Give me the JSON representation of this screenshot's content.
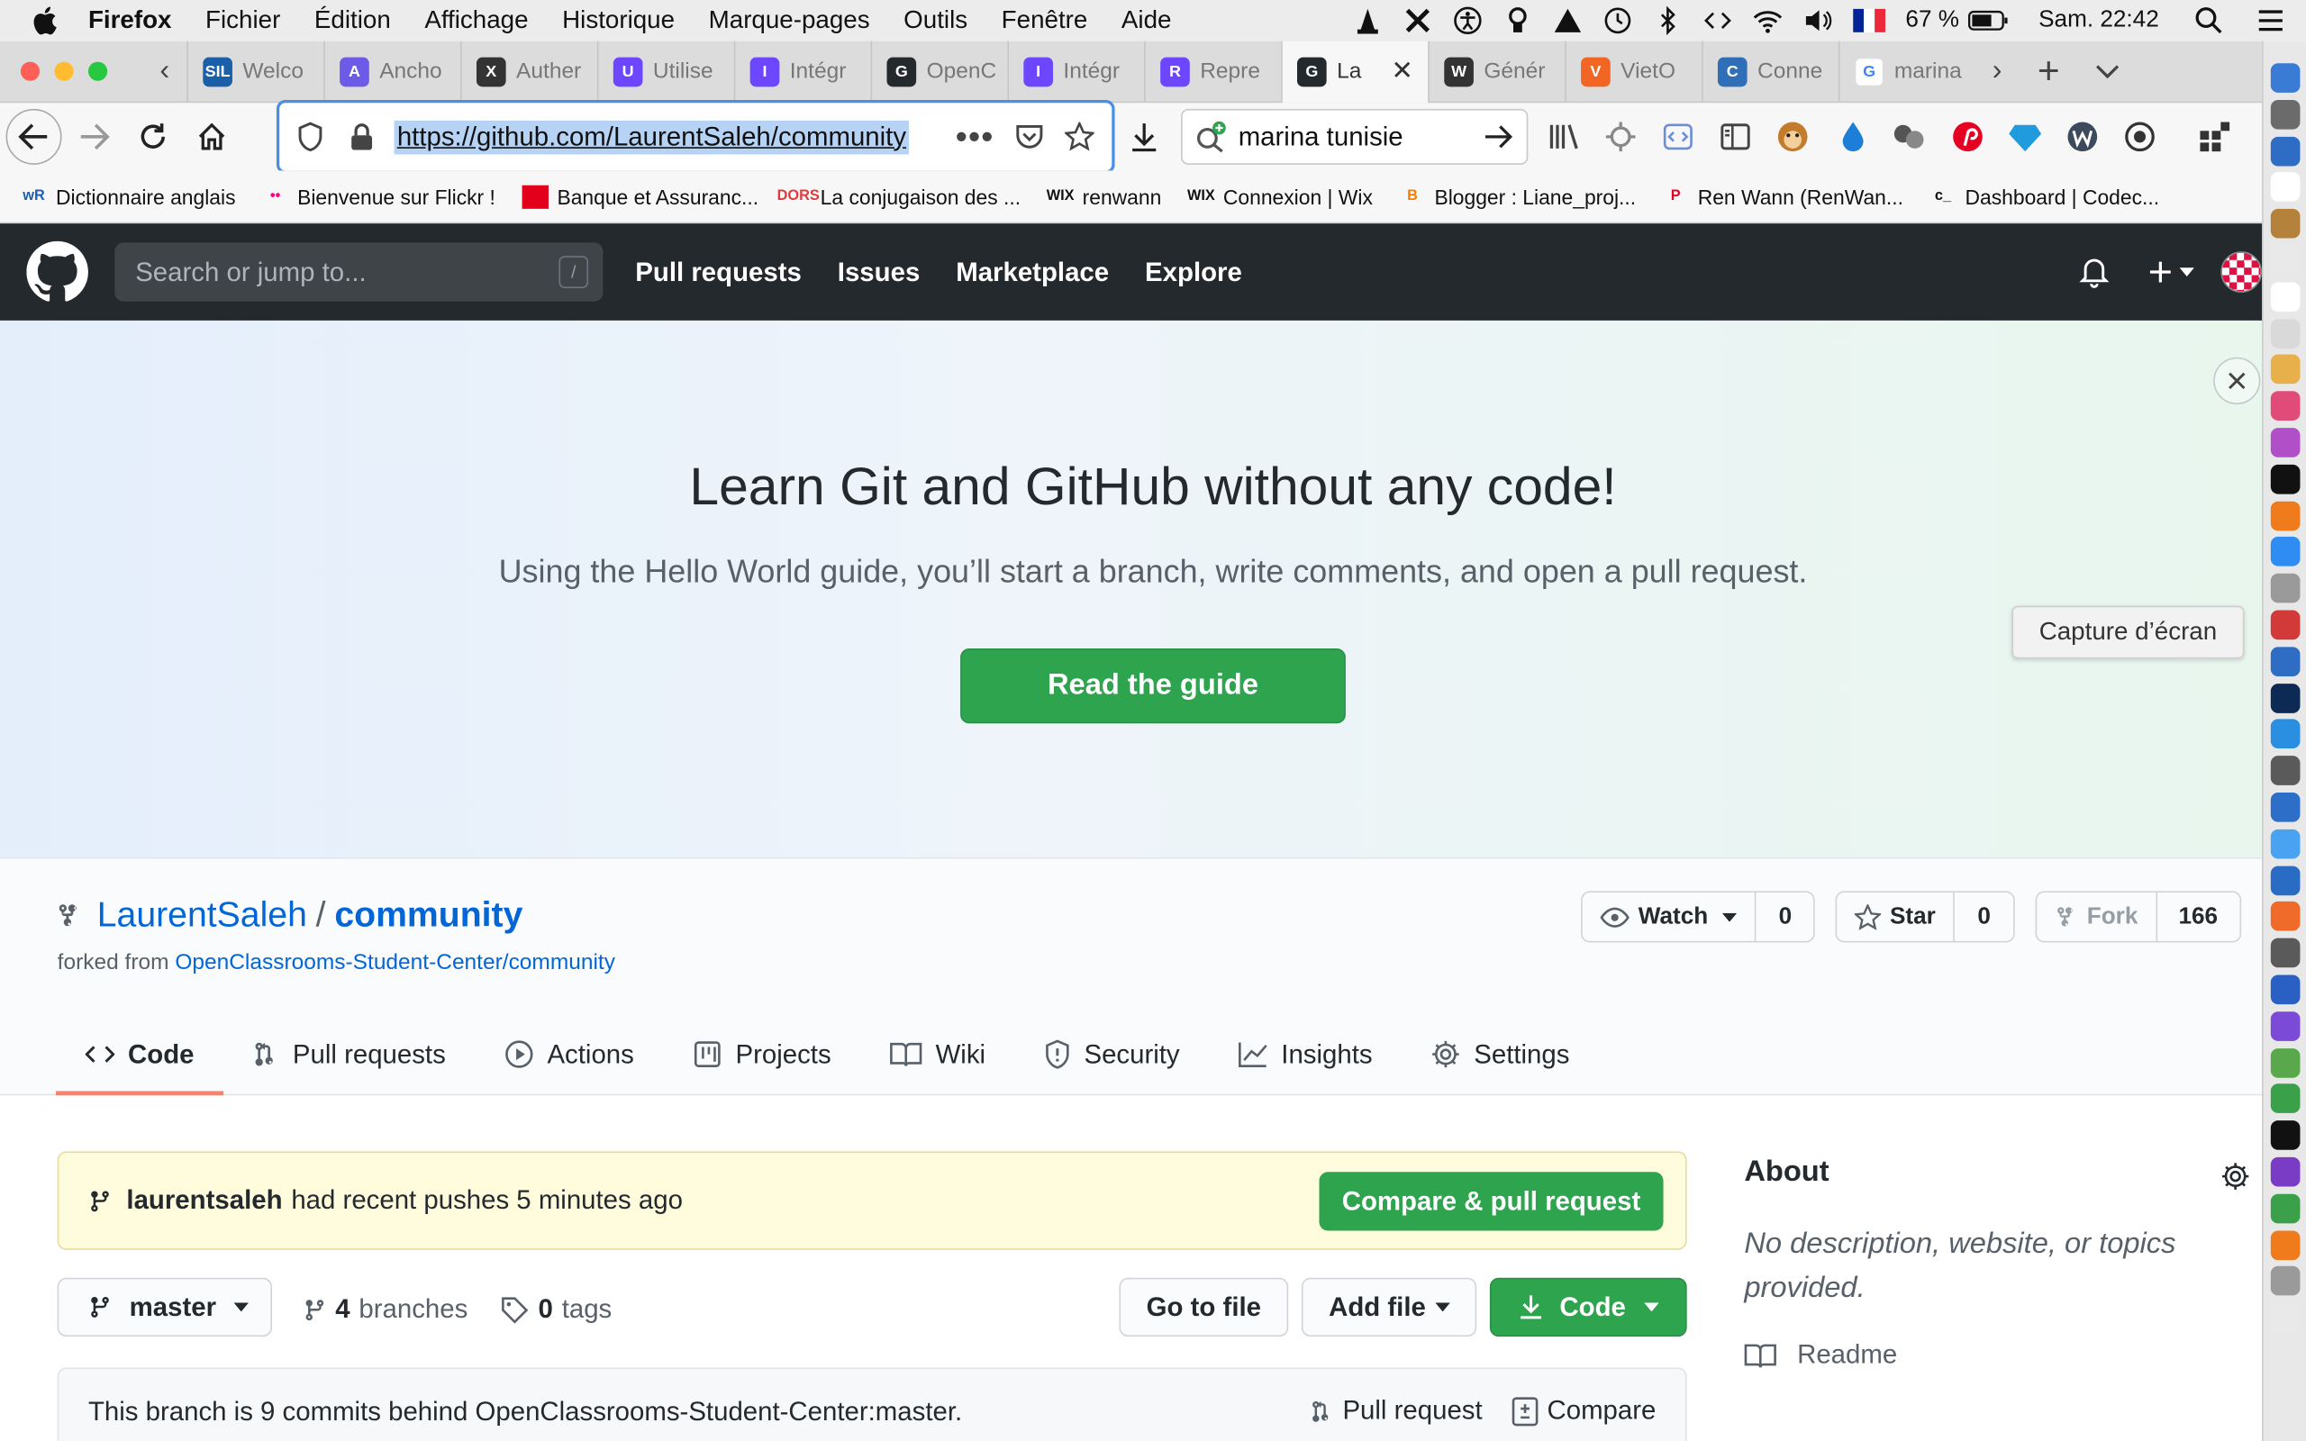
{
  "menubar": {
    "app": "Firefox",
    "items": [
      "Fichier",
      "Édition",
      "Affichage",
      "Historique",
      "Marque-pages",
      "Outils",
      "Fenêtre",
      "Aide"
    ],
    "battery": "67 %",
    "clock": "Sam. 22:42"
  },
  "tabs": [
    {
      "label": "Welco",
      "color": "#1b5fa8",
      "icon": "SIL"
    },
    {
      "label": "Ancho",
      "color": "#6d5ae6",
      "icon": "A"
    },
    {
      "label": "Auther",
      "color": "#333333",
      "icon": "X"
    },
    {
      "label": "Utilise",
      "color": "#6c47ff",
      "icon": "U"
    },
    {
      "label": "Intégr",
      "color": "#6c47ff",
      "icon": "I"
    },
    {
      "label": "OpenC",
      "color": "#24292e",
      "icon": "G"
    },
    {
      "label": "Intégr",
      "color": "#6c47ff",
      "icon": "I"
    },
    {
      "label": "Repre",
      "color": "#6c47ff",
      "icon": "R"
    },
    {
      "label": "La",
      "color": "#24292e",
      "icon": "G",
      "active": true
    },
    {
      "label": "Génér",
      "color": "#333333",
      "icon": "W"
    },
    {
      "label": "VietO",
      "color": "#f26522",
      "icon": "V"
    },
    {
      "label": "Conne",
      "color": "#2e6fb7",
      "icon": "C"
    },
    {
      "label": "marina",
      "color": "#ffffff",
      "icon": "G"
    }
  ],
  "nav": {
    "url": "https://github.com/LaurentSaleh/community",
    "search_value": "marina tunisie"
  },
  "bookmarks": [
    {
      "label": "Dictionnaire anglais",
      "icon": "wR",
      "color": "#1e5fb3"
    },
    {
      "label": "Bienvenue sur Flickr  !",
      "icon": "••",
      "color": "#ff0084"
    },
    {
      "label": "Banque et Assuranc...",
      "icon": "",
      "color": "#e2001a"
    },
    {
      "label": "La conjugaison des ...",
      "icon": "DORS",
      "color": "#e03a3e"
    },
    {
      "label": "renwann",
      "icon": "WIX",
      "color": "#111111"
    },
    {
      "label": "Connexion | Wix",
      "icon": "WIX",
      "color": "#111111"
    },
    {
      "label": "Blogger : Liane_proj...",
      "icon": "B",
      "color": "#f57d00"
    },
    {
      "label": "Ren Wann (RenWan...",
      "icon": "P",
      "color": "#e60023"
    },
    {
      "label": "Dashboard | Codec...",
      "icon": "c_",
      "color": "#111111"
    }
  ],
  "github": {
    "search_placeholder": "Search or jump to...",
    "slash_key": "/",
    "nav": [
      "Pull requests",
      "Issues",
      "Marketplace",
      "Explore"
    ]
  },
  "hero": {
    "title": "Learn Git and GitHub without any code!",
    "subtitle": "Using the Hello World guide, you’ll start a branch, write comments, and open a pull request.",
    "button": "Read the guide",
    "tooltip": "Capture d’écran"
  },
  "repo": {
    "owner": "LaurentSaleh",
    "separator": "/",
    "name": "community",
    "forked_prefix": "forked from ",
    "forked_from": "OpenClassrooms-Student-Center/community",
    "watch_label": "Watch",
    "watch_count": "0",
    "star_label": "Star",
    "star_count": "0",
    "fork_label": "Fork",
    "fork_count": "166",
    "tabs": [
      "Code",
      "Pull requests",
      "Actions",
      "Projects",
      "Wiki",
      "Security",
      "Insights",
      "Settings"
    ]
  },
  "body": {
    "push_user": "laurentsaleh",
    "push_text": "had recent pushes 5 minutes ago",
    "compare_button": "Compare & pull request",
    "branch": "master",
    "branches_count": "4",
    "branches_label": "branches",
    "tags_count": "0",
    "tags_label": "tags",
    "go_to_file": "Go to file",
    "add_file": "Add file",
    "code_button": "Code",
    "behind_text": "This branch is 9 commits behind OpenClassrooms-Student-Center:master.",
    "pull_request_link": "Pull request",
    "compare_link": "Compare"
  },
  "about": {
    "title": "About",
    "description": "No description, website, or topics provided.",
    "readme": "Readme"
  }
}
